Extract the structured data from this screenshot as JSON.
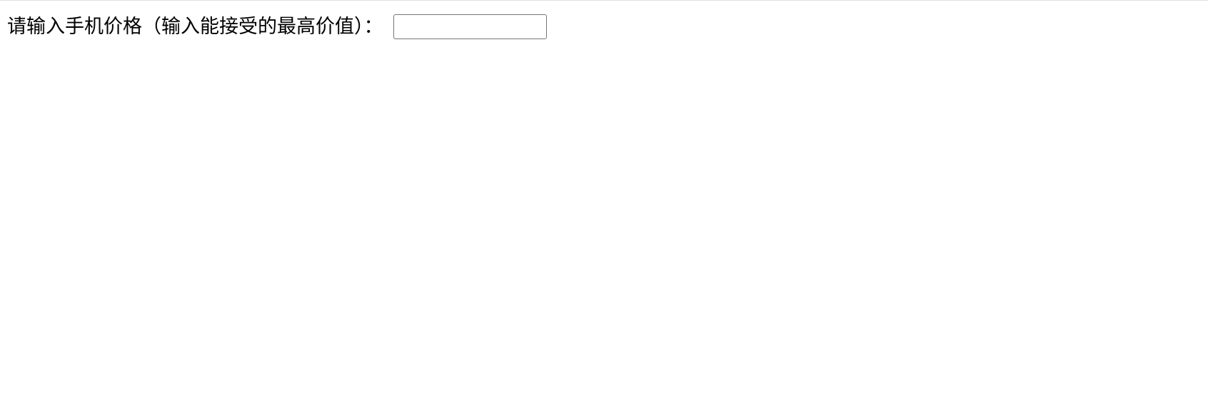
{
  "form": {
    "price_label": "请输入手机价格（输入能接受的最高价值）：",
    "price_value": ""
  }
}
